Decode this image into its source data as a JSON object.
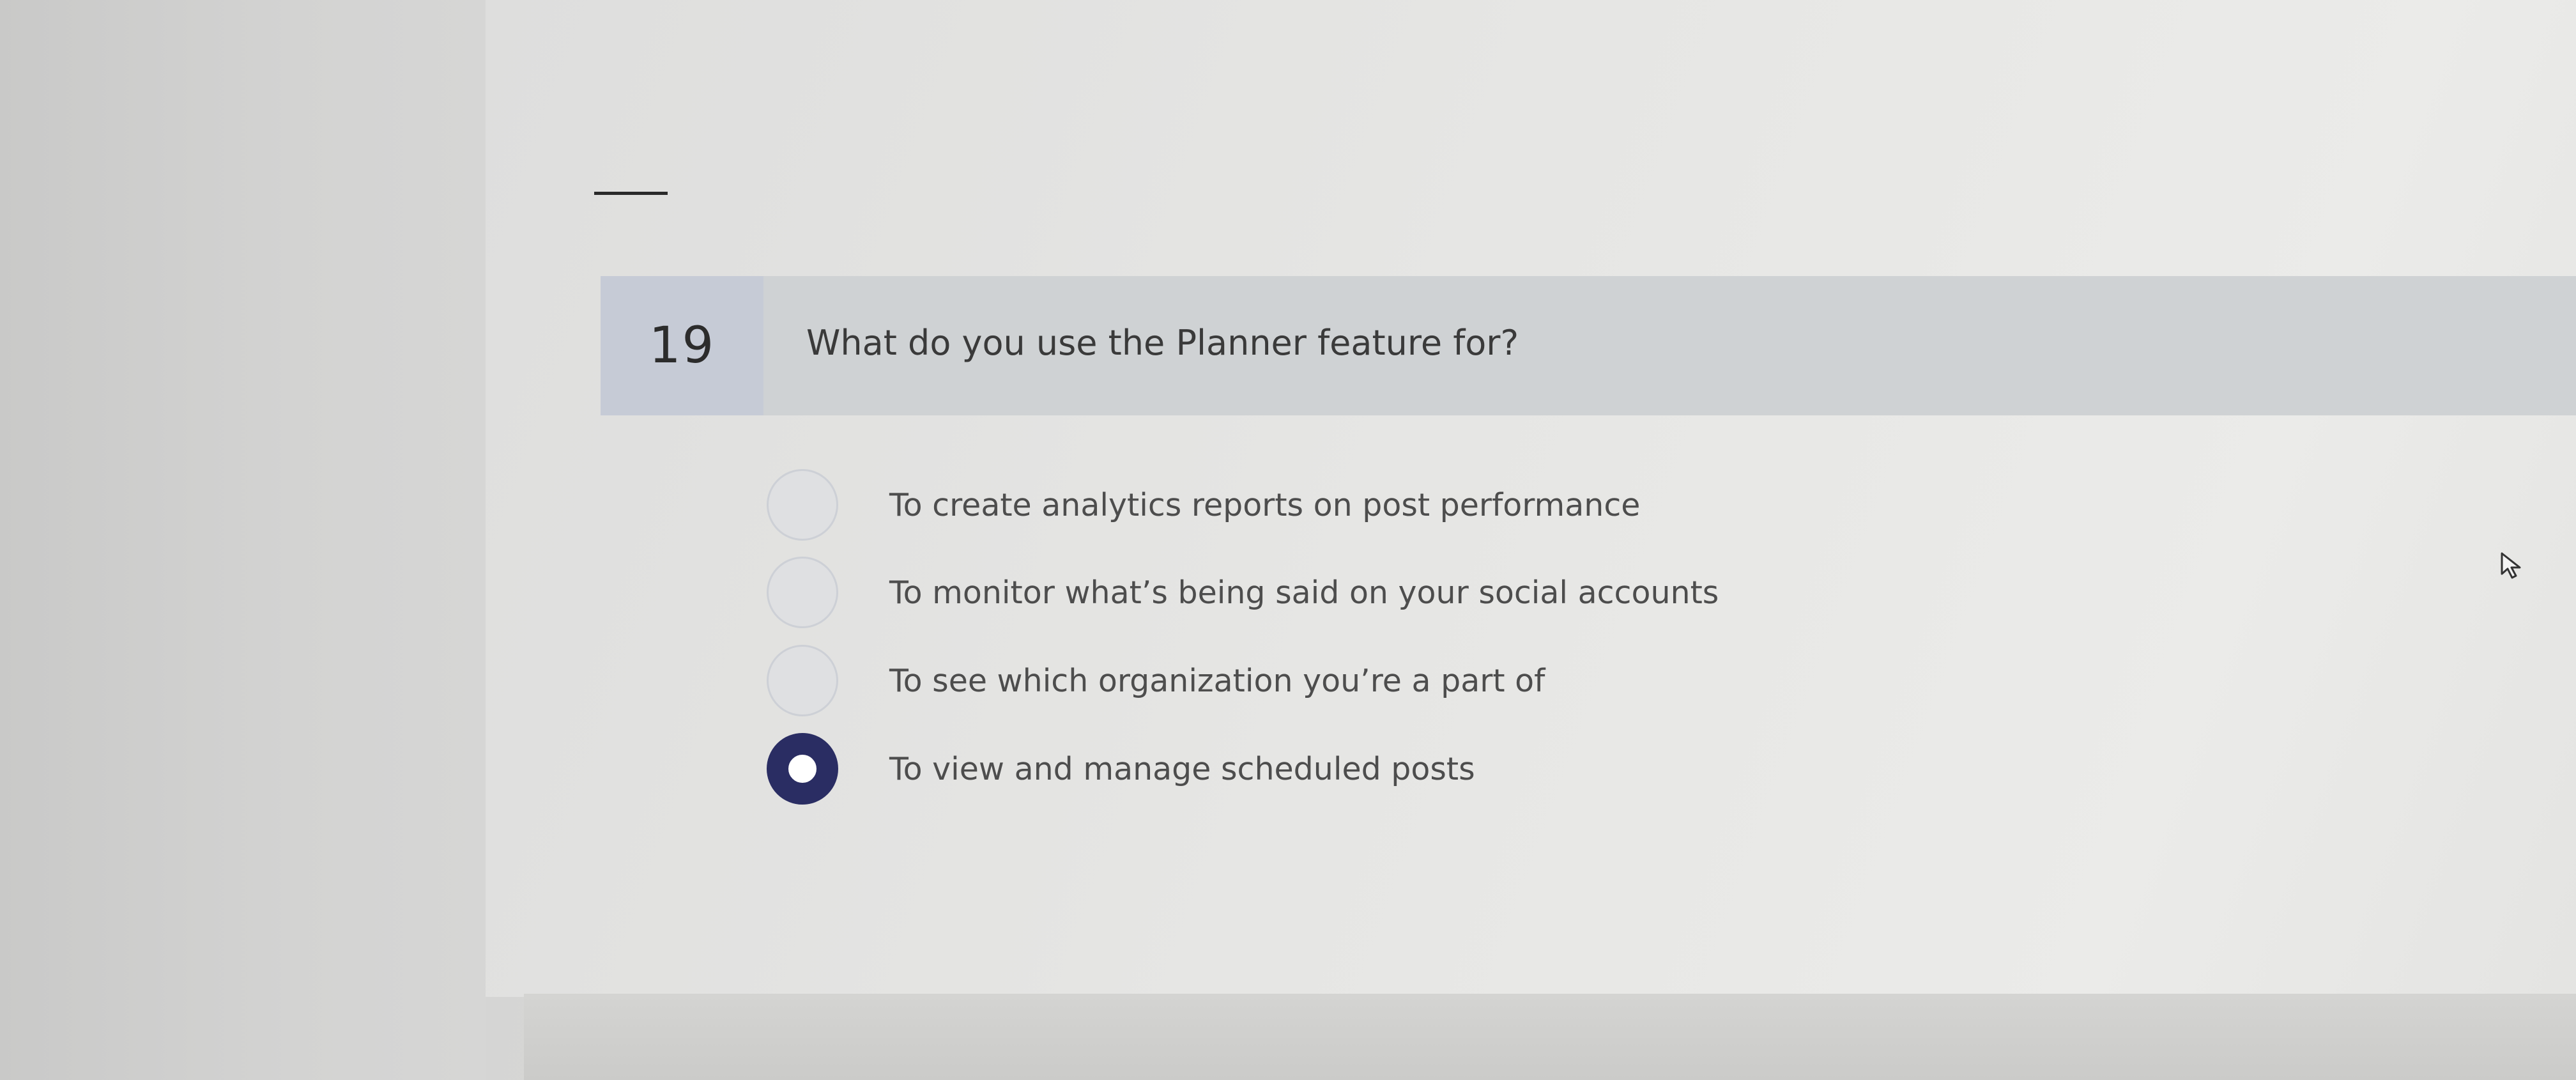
{
  "question": {
    "number": "19",
    "text": "What do you use the Planner feature for?"
  },
  "options": [
    {
      "label": "To create analytics reports on post performance",
      "selected": false
    },
    {
      "label": "To monitor what’s being said on your social accounts",
      "selected": false
    },
    {
      "label": "To see which organization you’re a part of",
      "selected": false
    },
    {
      "label": "To view and manage scheduled posts",
      "selected": true
    }
  ],
  "colors": {
    "selected_radio": "#2a2d63",
    "number_box": "#c6cbd6",
    "question_band": "#cfd2d4"
  },
  "icons": {
    "cursor": "mouse-pointer-icon"
  }
}
